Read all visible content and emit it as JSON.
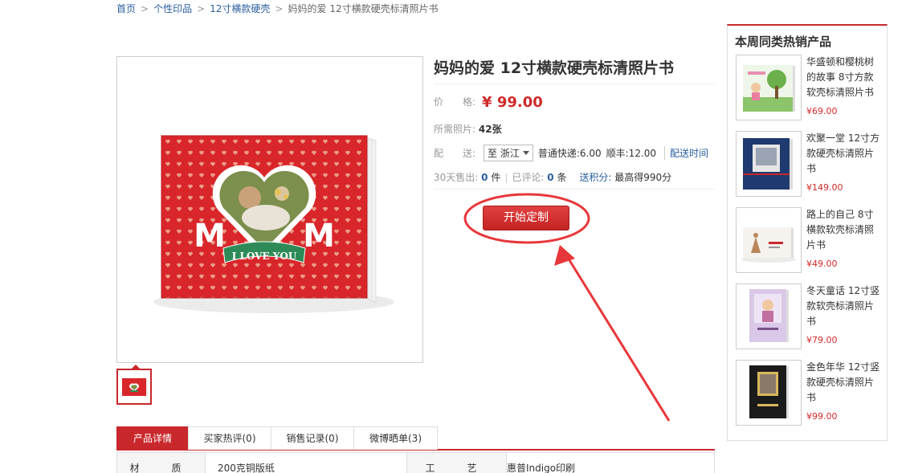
{
  "breadcrumb": {
    "items": [
      "首页",
      "个性印品",
      "12寸横款硬壳"
    ],
    "current": "妈妈的爱 12寸横款硬壳标清照片书",
    "separator": ">"
  },
  "product": {
    "title": "妈妈的爱 12寸横款硬壳标清照片书",
    "price_label": "价　　格:",
    "price": "¥ 99.00",
    "photos_label": "所需照片:",
    "photos_value": "42张",
    "shipping_label": "配　　送:",
    "shipping_dest": "至 浙江",
    "shipping_normal": "普通快递:6.00",
    "shipping_sf": "顺丰:12.00",
    "shipping_time_link": "配送时间",
    "sold_label": "30天售出:",
    "sold_count": "0",
    "sold_unit": "件",
    "review_label": "已评论:",
    "review_count": "0",
    "review_unit": "条",
    "points_label": "送积分:",
    "points_value": "最高得990分",
    "cta": "开始定制",
    "cover_text": "I LOVE YOU",
    "cover_letters": "M"
  },
  "colors": {
    "accent": "#c8282c",
    "price": "#d02a2a",
    "link": "#2a5fa0",
    "annotation": "#e8373a"
  },
  "tabs": [
    {
      "label": "产品详情",
      "active": true
    },
    {
      "label": "买家热评(0)",
      "active": false
    },
    {
      "label": "销售记录(0)",
      "active": false
    },
    {
      "label": "微博晒单(3)",
      "active": false
    }
  ],
  "spec": {
    "material_label": "材　质",
    "material_value": "200克铜版纸",
    "craft_label": "工　艺",
    "craft_value": "惠普Indigo印刷"
  },
  "sidebar": {
    "title": "本周同类热销产品",
    "items": [
      {
        "name": "华盛顿和樱桃树的故事 8寸方款软壳标清照片书",
        "price": "¥69.00"
      },
      {
        "name": "欢聚一堂 12寸方款硬壳标清照片书",
        "price": "¥149.00"
      },
      {
        "name": "路上的自己 8寸横款软壳标清照片书",
        "price": "¥49.00"
      },
      {
        "name": "冬天童话 12寸竖款软壳标清照片书",
        "price": "¥79.00"
      },
      {
        "name": "金色年华 12寸竖款硬壳标清照片书",
        "price": "¥99.00"
      }
    ]
  }
}
